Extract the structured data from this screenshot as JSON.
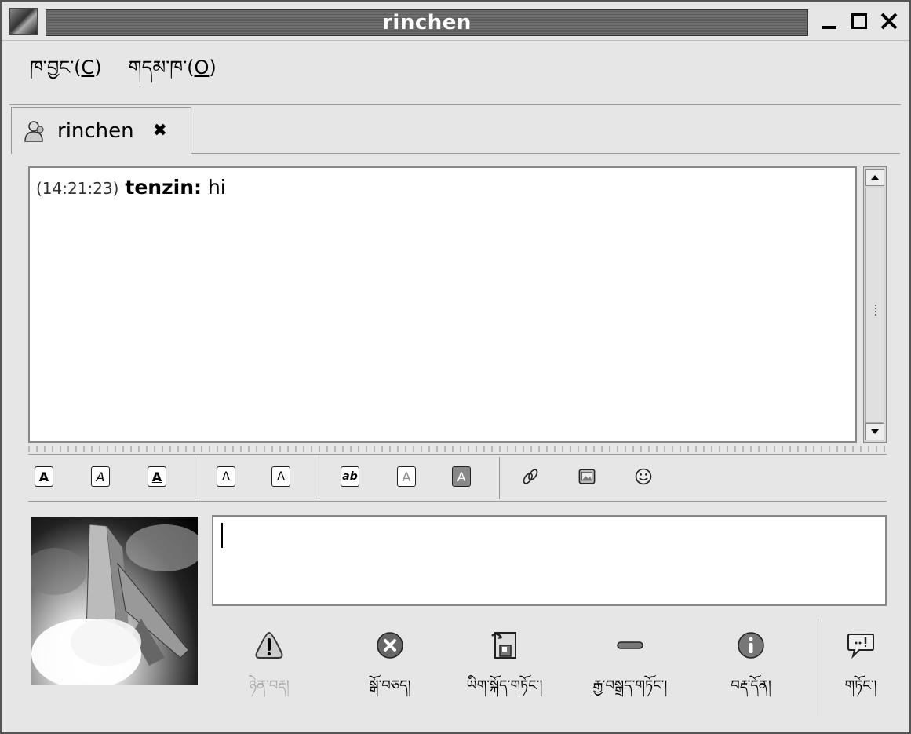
{
  "window": {
    "title": "rinchen"
  },
  "menu": [
    {
      "label": "ཁ་བྱང་(",
      "mnemonic": "C",
      "close": ")"
    },
    {
      "label": "གདམ་ཁ་(",
      "mnemonic": "O",
      "close": ")"
    }
  ],
  "tab": {
    "label": "rinchen",
    "close": "✖"
  },
  "conversation": {
    "messages": [
      {
        "timestamp": "(14:21:23)",
        "sender": "tenzin:",
        "text": " hi"
      }
    ]
  },
  "format_toolbar": {
    "bold": "A",
    "italic": "A",
    "underline": "A",
    "font_larger": "A",
    "font_smaller": "A",
    "font_face": "ab",
    "fg_color": "A",
    "bg_color": "A"
  },
  "entry": {
    "value": ""
  },
  "actions": [
    {
      "label": "ཉེན་བརྡ།",
      "icon": "warning-icon",
      "enabled": false
    },
    {
      "label": "སྒོ་བཅད།",
      "icon": "block-icon",
      "enabled": true
    },
    {
      "label": "ཡིག་སྐོད་གཏོང་།",
      "icon": "file-send-icon",
      "enabled": true
    },
    {
      "label": "རྒྱ་བསྒྲད་གཏོང་།",
      "icon": "remove-icon",
      "enabled": true
    },
    {
      "label": "བརྡ་དོན།",
      "icon": "info-icon",
      "enabled": true
    },
    {
      "label": "གཏོང་།",
      "icon": "send-icon",
      "enabled": true
    }
  ]
}
